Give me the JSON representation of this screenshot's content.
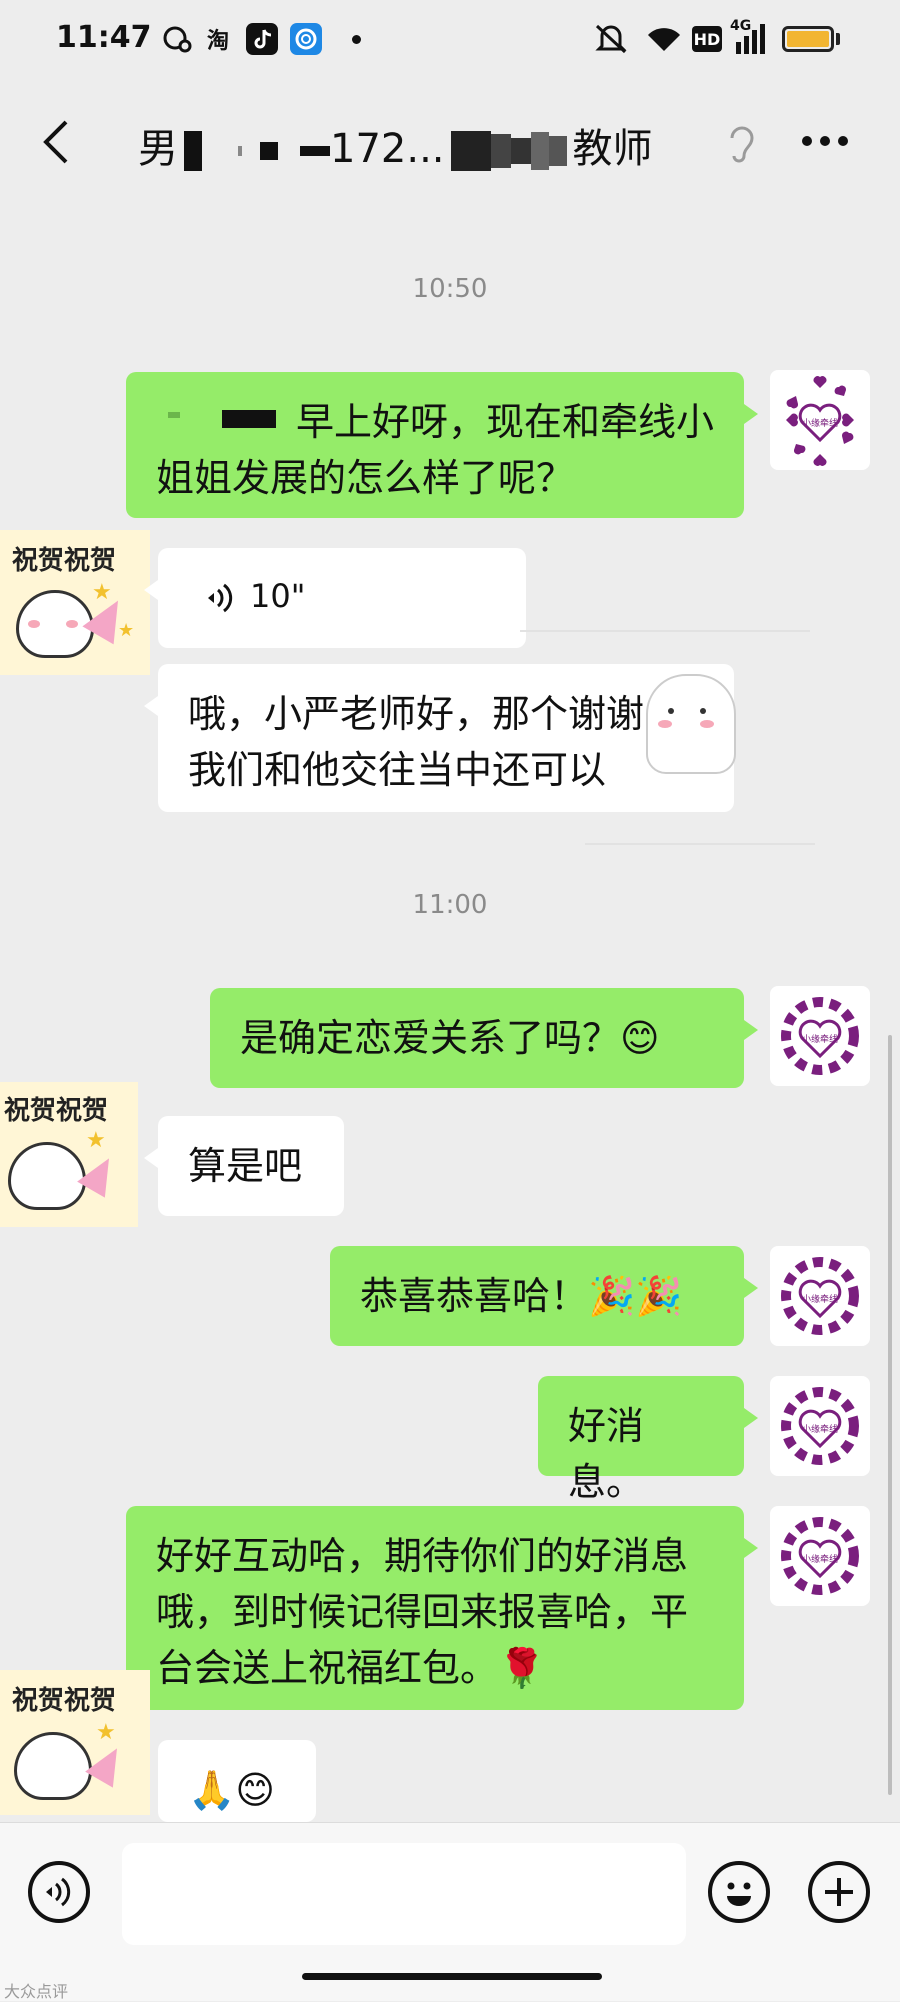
{
  "status_bar": {
    "time": "11:47",
    "notif_icons": [
      "chat-bubble-icon",
      "taobao-icon",
      "tiktok-icon",
      "app-icon",
      "dot-icon"
    ],
    "right_icons": [
      "mute-icon",
      "wifi-icon",
      "hd-icon",
      "4g-signal-icon",
      "battery-icon"
    ],
    "hd_label": "HD",
    "network_label": "4G",
    "battery_color": "#f2b531"
  },
  "nav": {
    "title_prefix": "男",
    "title_middle": "172...",
    "title_suffix": "教师"
  },
  "messages": {
    "ts1": "10:50",
    "m1": "早上好呀，现在和牵线小姐姐发展的怎么样了呢？",
    "voice_duration": "10\"",
    "m3": "哦，小严老师好，那个谢谢我们和他交往当中还可以",
    "ts2": "11:00",
    "m4": "是确定恋爱关系了吗？😊",
    "m5": "算是吧",
    "m6": "恭喜恭喜哈！🎉🎉",
    "m7": "好消息。",
    "m8": "好好互动哈，期待你们的好消息哦，到时候记得回来报喜哈，平台会送上祝福红包。🌹",
    "m9": "🙏😊"
  },
  "avatars": {
    "self_label": "小缘牵线",
    "user_sticker_text": "祝贺祝贺"
  },
  "colors": {
    "outgoing_bubble": "#95ec69",
    "incoming_bubble": "#ffffff",
    "background": "#ededed",
    "heart": "#7a1f7e"
  },
  "watermark": "大众点评"
}
